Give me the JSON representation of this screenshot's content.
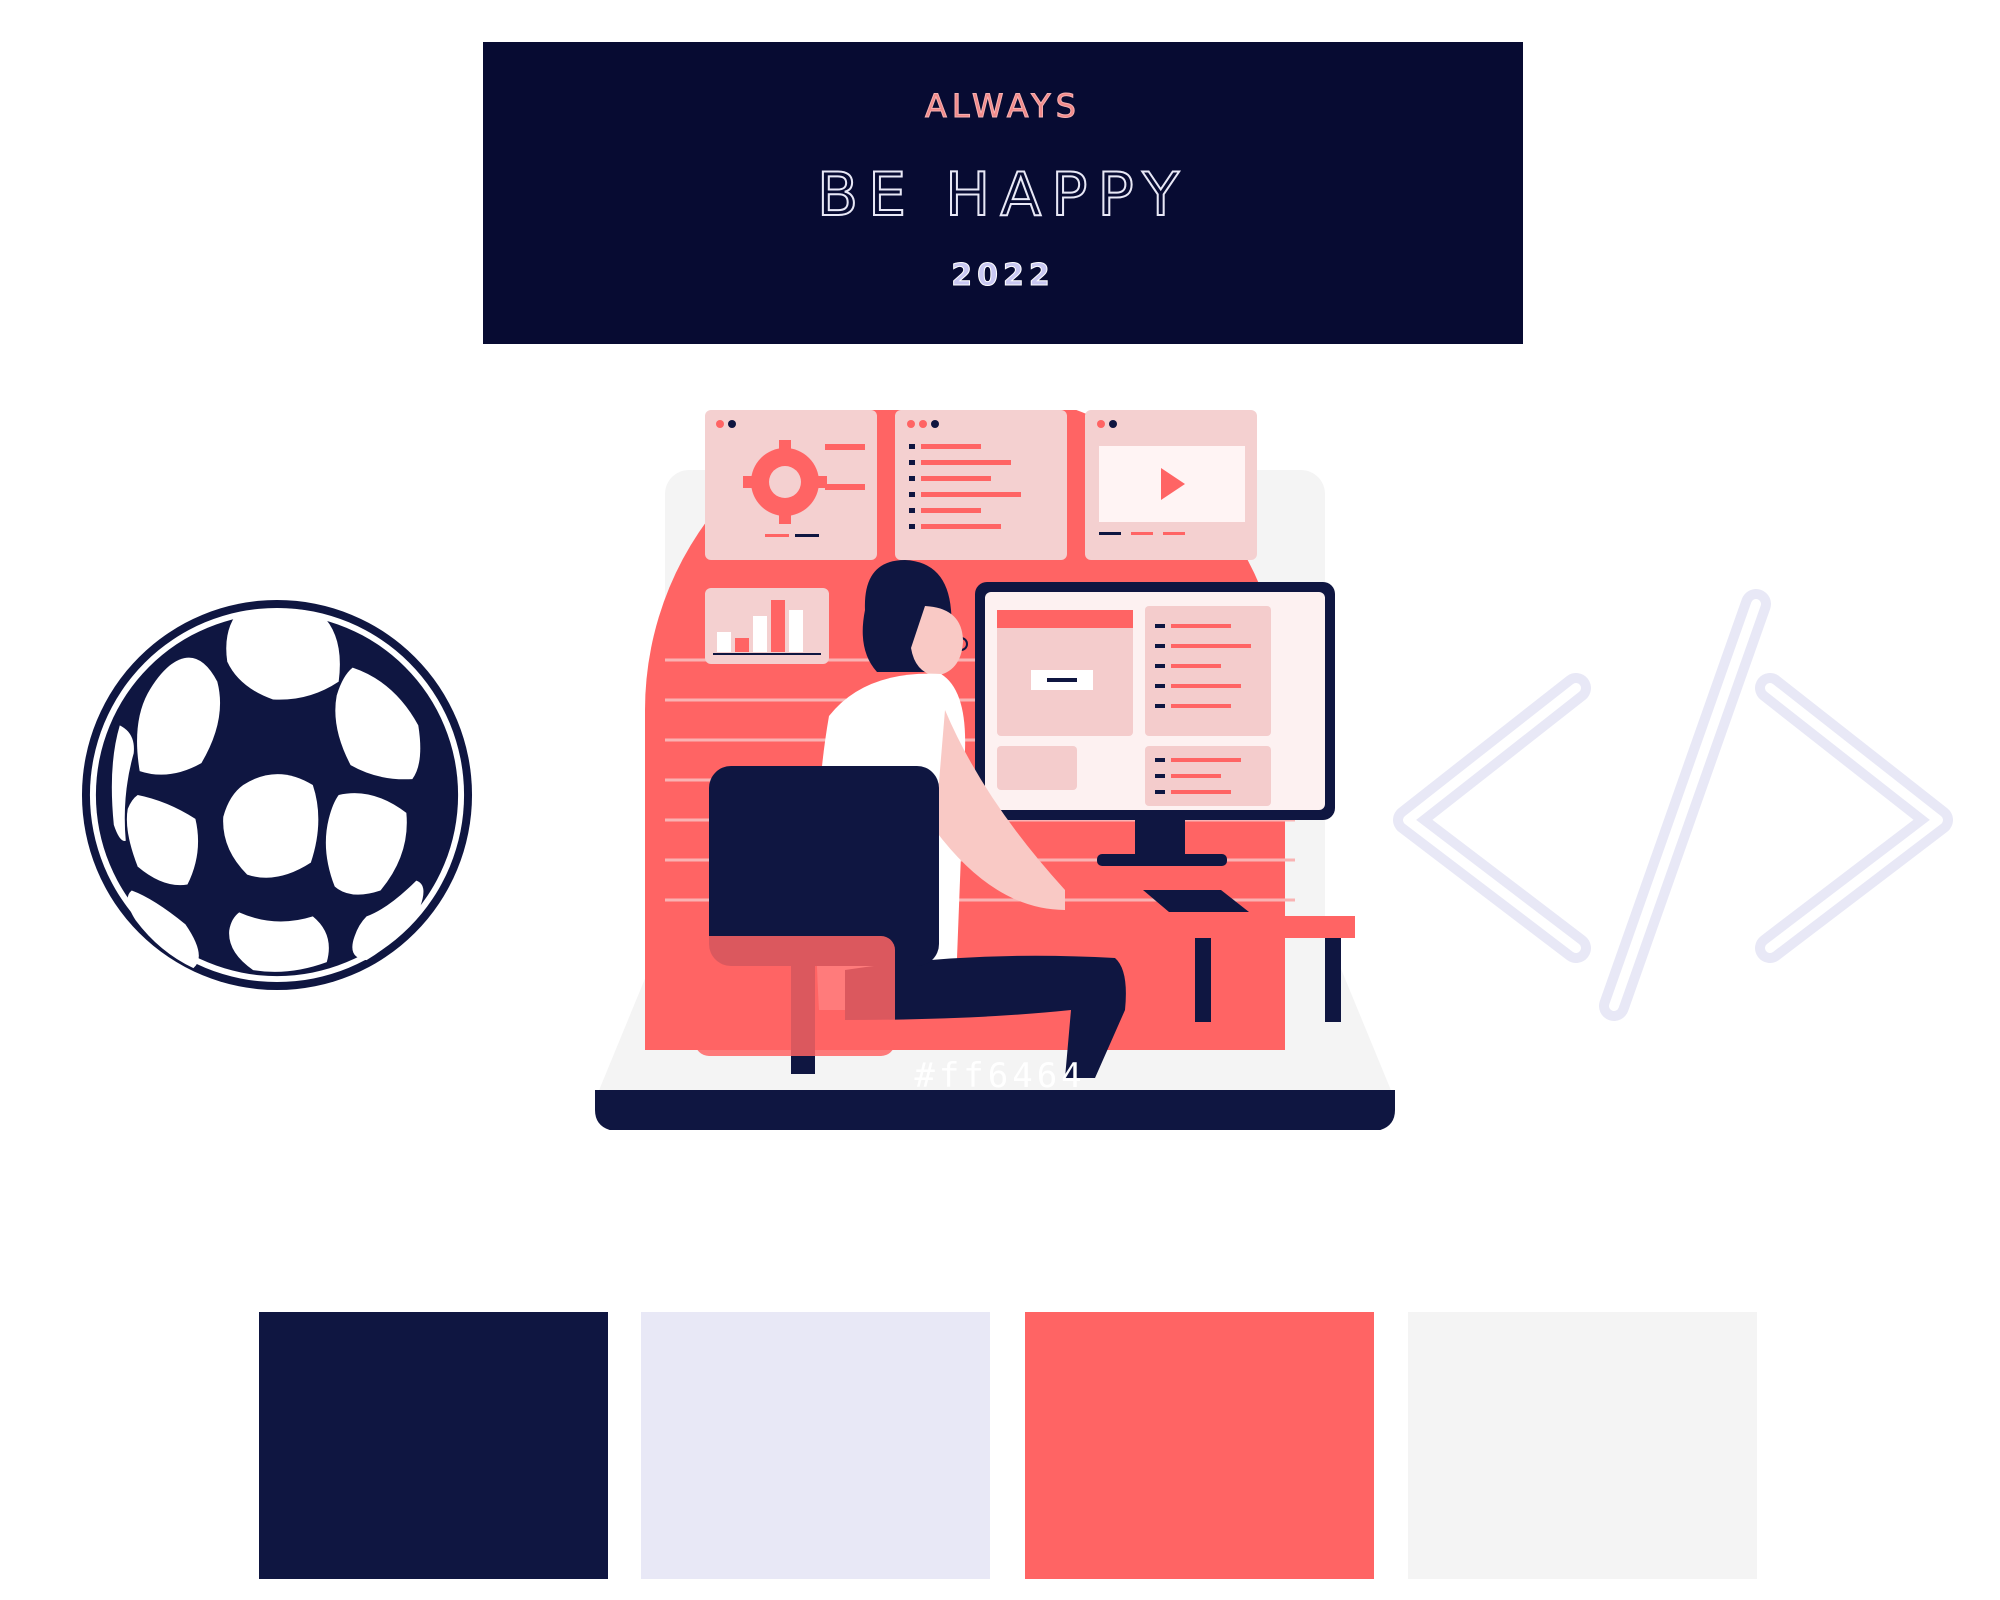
{
  "banner": {
    "line1": "ALWAYS",
    "line2": "BE HAPPY",
    "line3": "2022",
    "background": "#070b32"
  },
  "icons": {
    "left": "soccer-ball-icon",
    "right": "code-brackets-icon"
  },
  "illustration": {
    "subject": "person-at-computer-illustration",
    "label": "#ff6464"
  },
  "palette": [
    {
      "hex": "#0f1641"
    },
    {
      "hex": "#e8e8f6"
    },
    {
      "hex": "#ff6464"
    },
    {
      "hex": "#f4f4f4"
    }
  ]
}
